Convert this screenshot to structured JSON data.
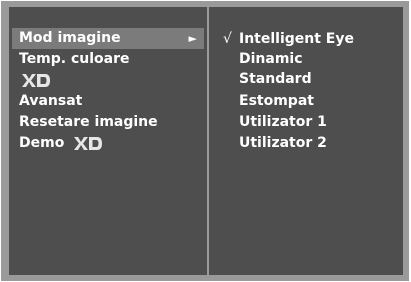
{
  "menu": {
    "items": [
      {
        "label": "Mod imagine",
        "selected": true,
        "submenu_arrow": "►"
      },
      {
        "label": "Temp. culoare"
      },
      {
        "label": "XD",
        "logo": true
      },
      {
        "label": "Avansat"
      },
      {
        "label": "Resetare imagine"
      },
      {
        "label": "Demo",
        "logo_after": "XD"
      }
    ]
  },
  "submenu": {
    "check_mark": "√",
    "options": [
      {
        "label": "Intelligent Eye",
        "checked": true
      },
      {
        "label": "Dinamic"
      },
      {
        "label": "Standard"
      },
      {
        "label": "Estompat"
      },
      {
        "label": "Utilizator 1"
      },
      {
        "label": "Utilizator 2"
      }
    ]
  },
  "colors": {
    "panel_bg": "#4e4e4e",
    "highlight": "#7b7b7b",
    "frame": "#9a9a9a",
    "text": "#ffffff"
  }
}
